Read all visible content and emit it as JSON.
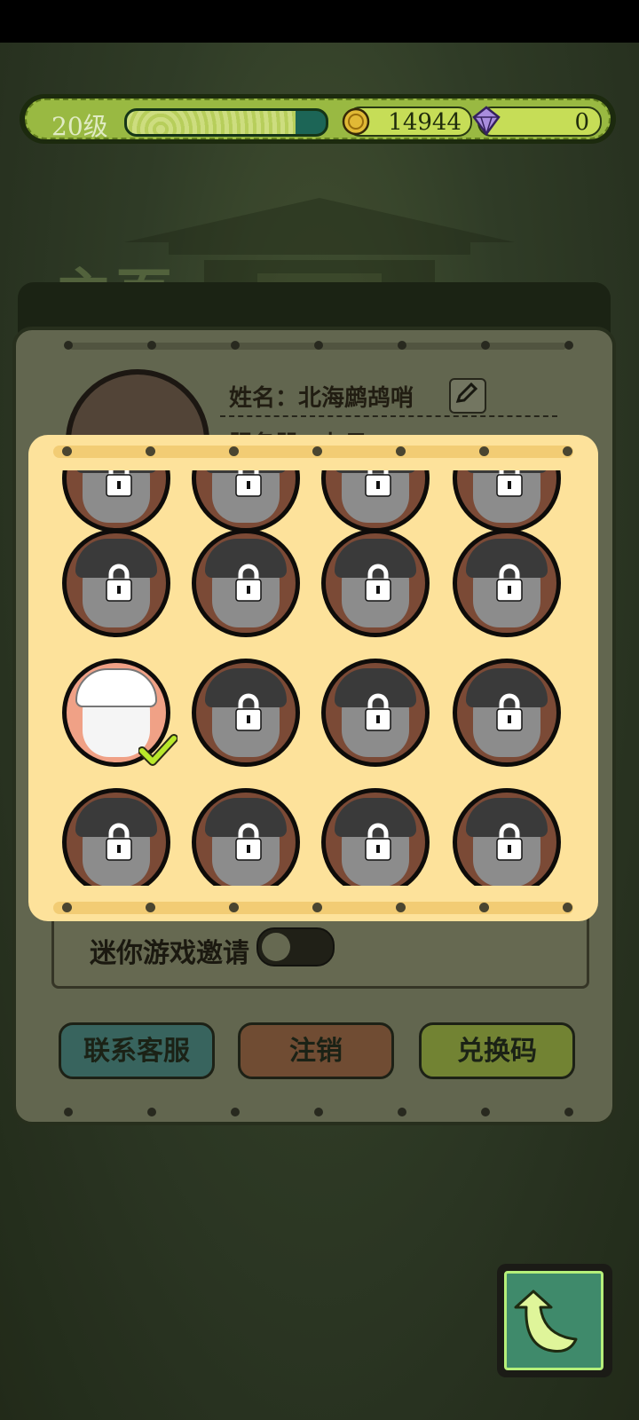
{
  "topbar": {
    "level_label": "20级",
    "xp_progress": 0.85,
    "coins": "14944",
    "gems": "0",
    "coin_icon": "gold-coin-icon",
    "gem_icon": "purple-gem-icon"
  },
  "page": {
    "title": "主页",
    "name_label": "姓名：北海鹧鸪哨",
    "server_label": "服务器：九日",
    "mini_game_invite_label": "迷你游戏邀请",
    "mini_game_invite_enabled": false
  },
  "buttons": {
    "support": "联系客服",
    "logout": "注销",
    "redeem": "兑换码"
  },
  "avatar_picker": {
    "selected_index": 8,
    "avatars": [
      {
        "locked": true
      },
      {
        "locked": true
      },
      {
        "locked": true
      },
      {
        "locked": true
      },
      {
        "locked": true
      },
      {
        "locked": true
      },
      {
        "locked": true
      },
      {
        "locked": true
      },
      {
        "locked": false,
        "selected": true
      },
      {
        "locked": true
      },
      {
        "locked": true
      },
      {
        "locked": true
      },
      {
        "locked": true
      },
      {
        "locked": true
      },
      {
        "locked": true
      },
      {
        "locked": true
      }
    ]
  },
  "colors": {
    "accent_green": "#a7c948",
    "panel_yellow": "#fde29b",
    "avatar_brown": "#7b4a36",
    "check_green": "#b9e82b"
  },
  "back_button_icon": "back-arrow-icon"
}
